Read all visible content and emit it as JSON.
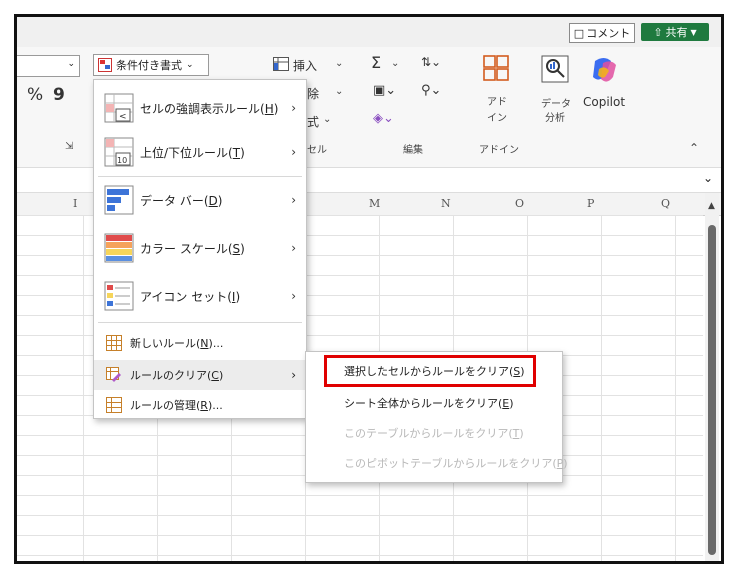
{
  "topbar": {
    "comment_label": "コメント",
    "share_label": "共有"
  },
  "ribbon": {
    "percent_symbol": "%",
    "comma_symbol": "9",
    "conditional_format_label": "条件付き書式",
    "insert_label": "挿入",
    "delete_label": "除",
    "format_label": "式",
    "cells_group_label": "セル",
    "sigma_symbol": "Σ",
    "editing_group_label": "編集",
    "addin_label_1": "アド",
    "addin_label_2": "イン",
    "addin_group_label": "アドイン",
    "data_analysis_label_1": "データ",
    "data_analysis_label_2": "分析",
    "copilot_label": "Copilot"
  },
  "columns": [
    "I",
    "M",
    "N",
    "O",
    "P",
    "Q"
  ],
  "menu": {
    "items": [
      {
        "label": "セルの強調表示ルール",
        "key": "H"
      },
      {
        "label": "上位/下位ルール",
        "key": "T"
      },
      {
        "label": "データ バー",
        "key": "D"
      },
      {
        "label": "カラー スケール",
        "key": "S"
      },
      {
        "label": "アイコン セット",
        "key": "I"
      }
    ],
    "small_items": [
      {
        "label": "新しいルール",
        "key": "N",
        "suffix": "..."
      },
      {
        "label": "ルールのクリア",
        "key": "C",
        "suffix": ""
      },
      {
        "label": "ルールの管理",
        "key": "R",
        "suffix": "..."
      }
    ]
  },
  "submenu": {
    "items": [
      {
        "label": "選択したセルからルールをクリア",
        "key": "S",
        "disabled": false
      },
      {
        "label": "シート全体からルールをクリア",
        "key": "E",
        "disabled": false
      },
      {
        "label": "このテーブルからルールをクリア",
        "key": "T",
        "disabled": true
      },
      {
        "label": "このピボットテーブルからルールをクリア",
        "key": "P",
        "disabled": true
      }
    ]
  },
  "colors": {
    "share_green": "#1f7a3f",
    "highlight_red": "#e00000",
    "copilot_blue": "#3b6df0"
  }
}
